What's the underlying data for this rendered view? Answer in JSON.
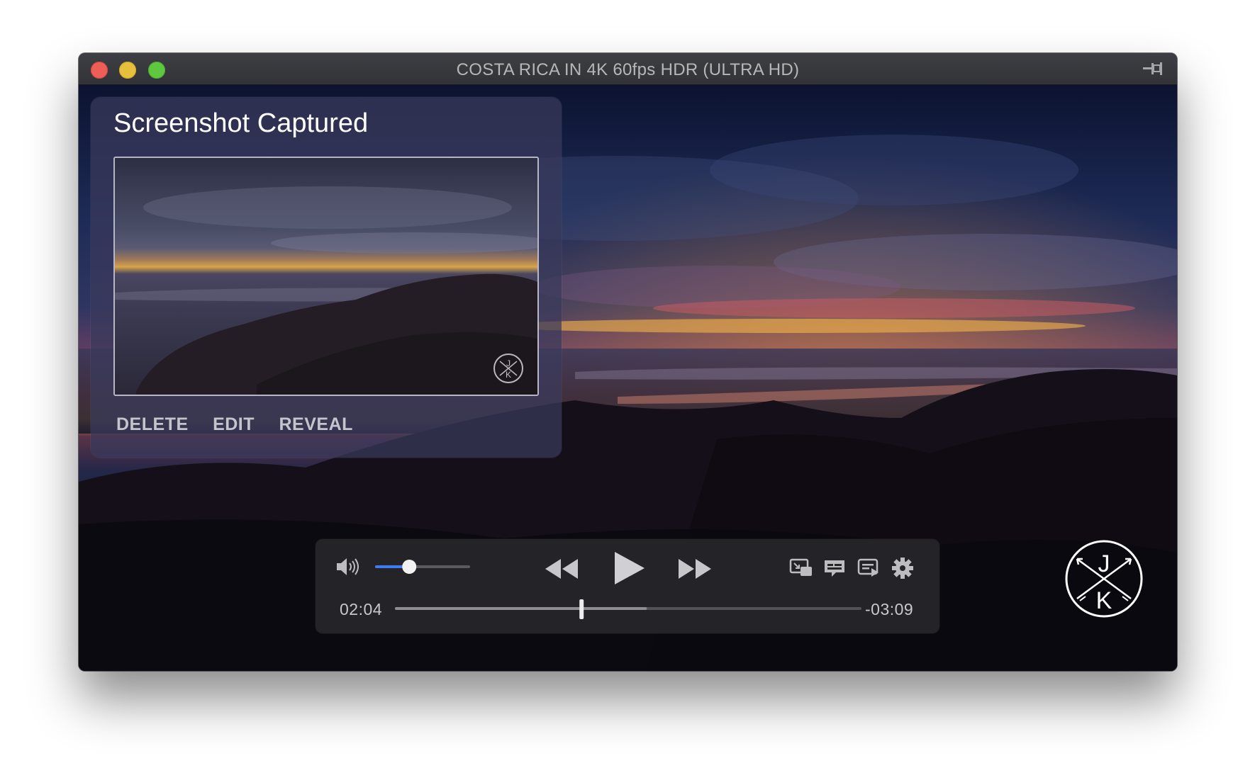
{
  "window": {
    "title": "COSTA RICA IN 4K 60fps HDR (ULTRA HD)"
  },
  "icons": {
    "close": "close-icon",
    "minimize": "minimize-icon",
    "maximize": "maximize-icon",
    "pin": "pin-icon",
    "volume": "speaker-volume-icon",
    "rewind": "rewind-icon",
    "play": "play-icon",
    "fast_forward": "fast-forward-icon",
    "picture_in_picture": "picture-in-picture-icon",
    "subtitles": "subtitles-icon",
    "playlist": "playlist-icon",
    "settings": "gear-icon",
    "logo": "jk-crossed-arrows-logo"
  },
  "capture": {
    "title": "Screenshot Captured",
    "actions": [
      "DELETE",
      "EDIT",
      "REVEAL"
    ]
  },
  "player": {
    "elapsed": "02:04",
    "remaining": "-03:09",
    "progress_fraction": 0.4,
    "buffered_fraction": 0.54,
    "volume_fraction": 0.36
  },
  "logo": {
    "letters": [
      "J",
      "K"
    ]
  },
  "colors": {
    "accent": "#3b7cf5",
    "traffic_close": "#ed5f56",
    "traffic_minimize": "#e6c03c",
    "traffic_maximize": "#5fc63f"
  }
}
